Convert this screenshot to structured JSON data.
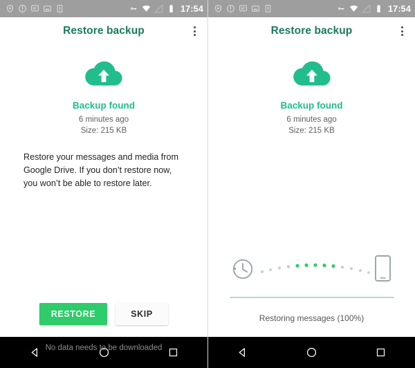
{
  "colors": {
    "accent_green": "#2ecc6a",
    "teal": "#21bd8c",
    "title_green": "#1a7a5e",
    "statusbar_grey": "#9e9e9e",
    "navbar_black": "#000000",
    "progress_fill": "#a9dfc3",
    "dot_active": "#2ecc6a",
    "dot_inactive": "#c9cfd2"
  },
  "status_bar": {
    "time": "17:54",
    "left_icons": [
      "shield-icon",
      "download-alert-icon",
      "sync-message-icon",
      "screenshot-icon",
      "sim-card-icon"
    ],
    "right_icons": [
      "vpn-key-icon",
      "wifi-icon",
      "signal-off-icon",
      "battery-icon"
    ]
  },
  "app_bar": {
    "title": "Restore backup",
    "overflow_menu": "more-options"
  },
  "left_screen": {
    "cloud_icon": "cloud-upload-icon",
    "heading": "Backup found",
    "timestamp": "6 minutes ago",
    "size": "Size: 215 KB",
    "body": "Restore your messages and media from Google Drive. If you don’t restore now, you won’t be able to restore later.",
    "restore_label": "RESTORE",
    "skip_label": "SKIP",
    "footnote": "No data needs to be downloaded"
  },
  "right_screen": {
    "cloud_icon": "cloud-upload-icon",
    "heading": "Backup found",
    "timestamp": "6 minutes ago",
    "size": "Size: 215 KB",
    "transfer": {
      "source_icon": "history-icon",
      "target_icon": "smartphone-icon",
      "dot_count": 13,
      "active_dots": [
        4,
        5,
        6,
        7,
        8
      ]
    },
    "progress_percent": 100,
    "progress_label": "Restoring messages (100%)"
  },
  "nav_bar": {
    "back": "back-triangle-icon",
    "home": "home-circle-icon",
    "recents": "recents-square-icon"
  }
}
